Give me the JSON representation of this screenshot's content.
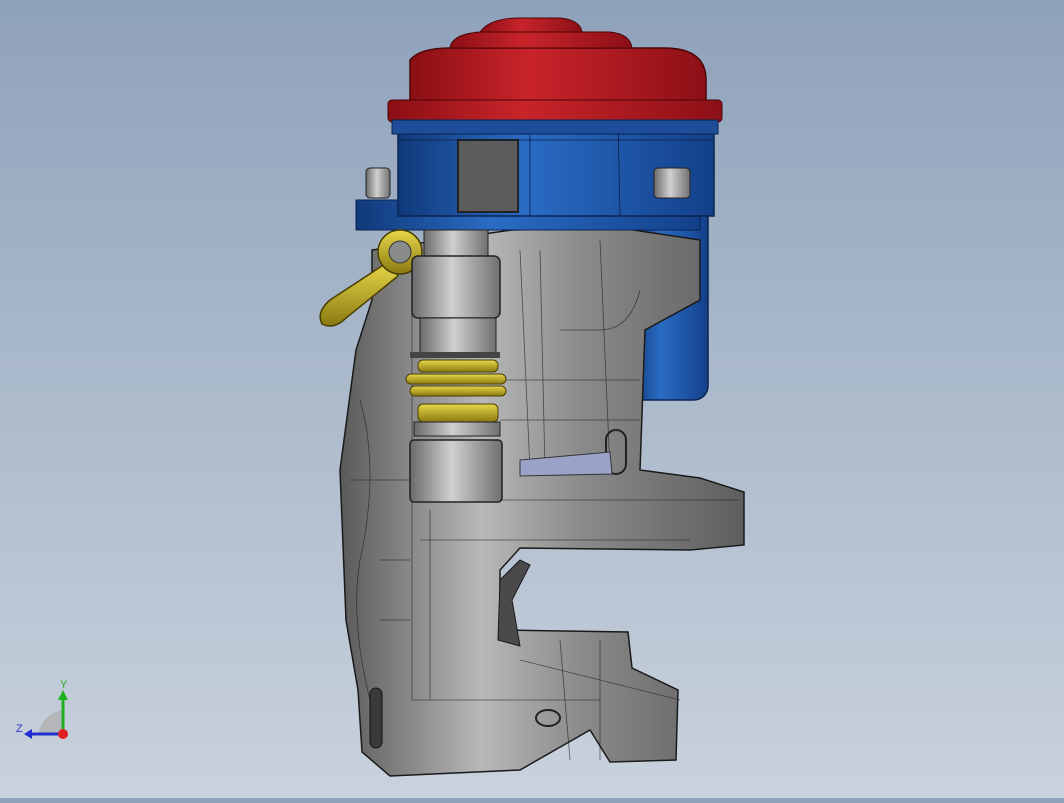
{
  "viewport": {
    "background_top": "#8fa2bb",
    "background_bottom": "#c9d2dd",
    "model_colors": {
      "cap_red": "#b3181d",
      "body_blue": "#1d56a8",
      "casting_gray": "#7c7c7c",
      "hardware_yellow": "#c8b21e"
    }
  },
  "triad": {
    "y_label": "Y",
    "z_label": "Z",
    "x_color": "#e02020",
    "y_color": "#20b020",
    "z_color": "#2030d0"
  }
}
